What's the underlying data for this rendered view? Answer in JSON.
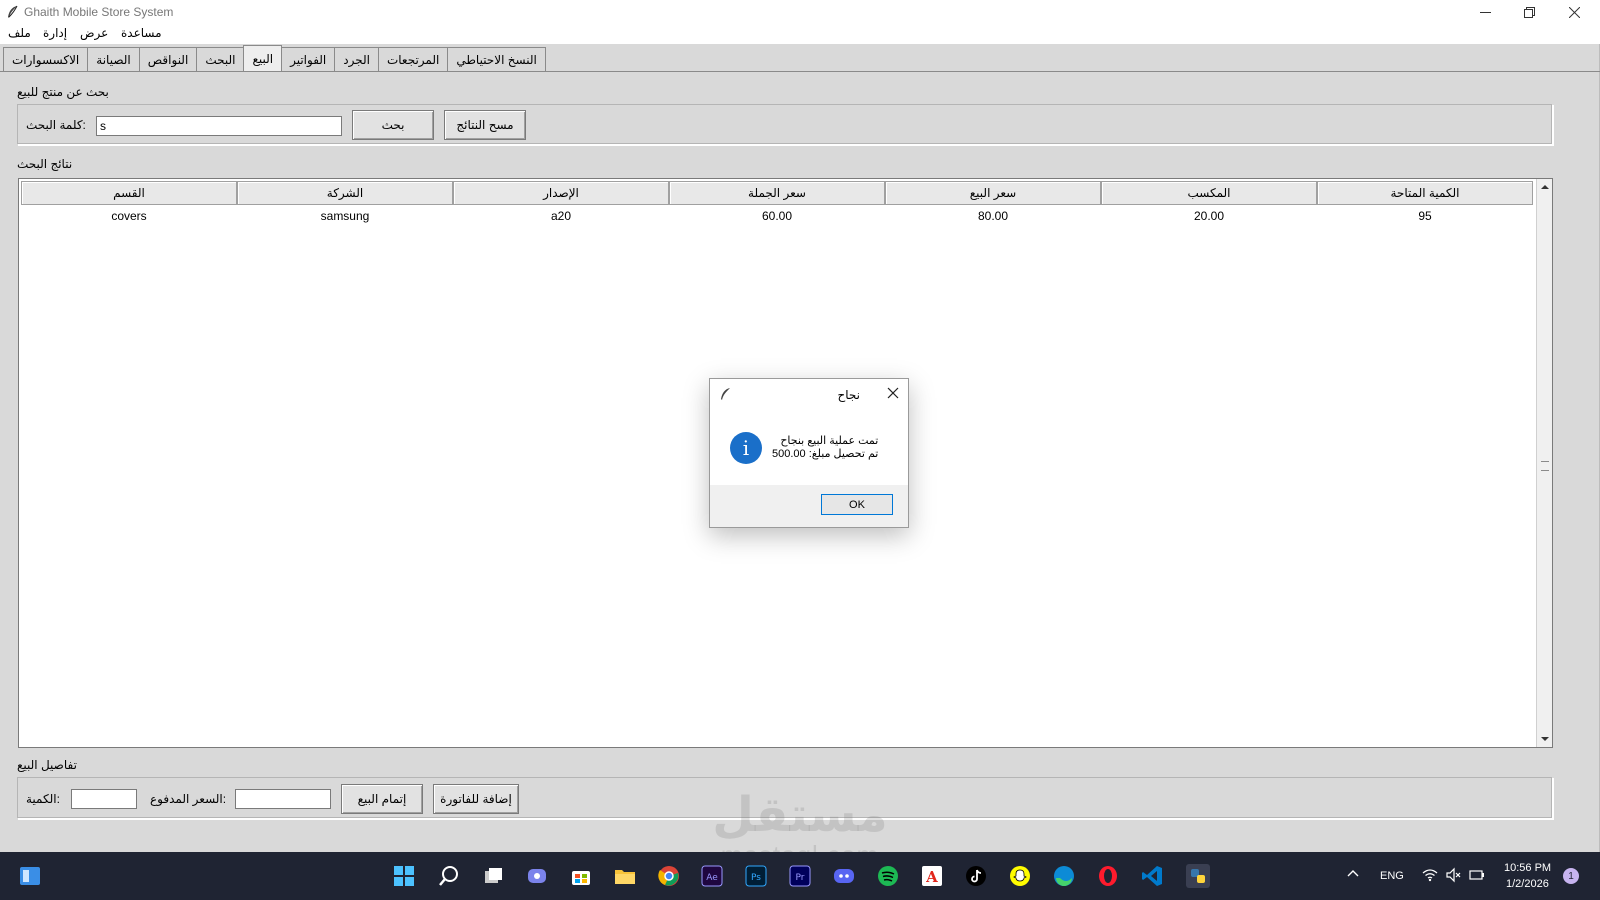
{
  "window": {
    "title": "Ghaith Mobile Store System"
  },
  "menu": [
    "ملف",
    "إدارة",
    "عرض",
    "مساعدة"
  ],
  "tabs": [
    {
      "label": "الاكسسوارات"
    },
    {
      "label": "الصيانة"
    },
    {
      "label": "النواقص"
    },
    {
      "label": "البحث"
    },
    {
      "label": "البيع",
      "active": true
    },
    {
      "label": "الفواتير"
    },
    {
      "label": "الجرد"
    },
    {
      "label": "المرتجعات"
    },
    {
      "label": "النسخ الاحتياطي"
    }
  ],
  "search_section": {
    "title": "بحث عن منتج للبيع",
    "keyword_label": "كلمة البحث:",
    "keyword_value": "s",
    "search_button": "بحث",
    "clear_button": "مسح النتائج"
  },
  "results": {
    "title": "نتائج البحث",
    "columns": [
      "القسم",
      "الشركة",
      "الإصدار",
      "سعر الجملة",
      "سعر البيع",
      "المكسب",
      "الكمية المتاحة"
    ],
    "rows": [
      [
        "covers",
        "samsung",
        "a20",
        "60.00",
        "80.00",
        "20.00",
        "95"
      ]
    ]
  },
  "sale_details": {
    "title": "تفاصيل البيع",
    "quantity_label": "الكمية:",
    "quantity_value": "",
    "paid_label": "السعر المدفوع:",
    "paid_value": "",
    "complete_button": "إتمام البيع",
    "add_invoice_button": "إضافة للفاتورة"
  },
  "dialog": {
    "title": "نجاح",
    "line1": "تمت عملية البيع بنجاح",
    "line2": "تم تحصيل مبلغ: 500.00",
    "ok_label": "OK"
  },
  "watermark": {
    "big": "مستقل",
    "small": "mostaql.com"
  },
  "taskbar": {
    "language": "ENG",
    "time": "10:56 PM",
    "date": "1/2/2026",
    "notification_count": "1"
  },
  "colors": {
    "window_bg": "#d9d9d9",
    "taskbar_bg": "#1f2433",
    "info_blue": "#1a6fc9",
    "ok_border": "#0078d7"
  }
}
